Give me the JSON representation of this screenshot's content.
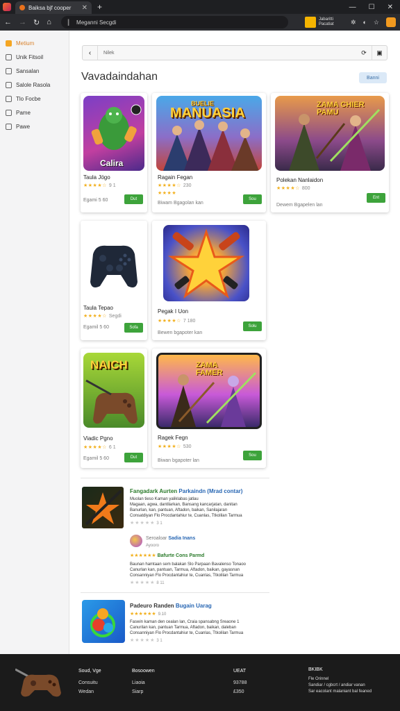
{
  "browser": {
    "tab_title": "Baiksa bjf cooper",
    "address": "Meganni Secgdi",
    "profile_name": "Jabaritti Pacatiat"
  },
  "sidebar": {
    "items": [
      {
        "label": "Metium",
        "icon": "home-icon",
        "active": true
      },
      {
        "label": "Unik Fitsoil",
        "icon": "list-icon"
      },
      {
        "label": "Sansalan",
        "icon": "bookmark-icon"
      },
      {
        "label": "Salole Rasola",
        "icon": "document-icon"
      },
      {
        "label": "Tlo Focbe",
        "icon": "circle-icon"
      },
      {
        "label": "Pame",
        "icon": "square-icon"
      },
      {
        "label": "Pawe",
        "icon": "square-icon"
      }
    ]
  },
  "toolbar": {
    "search_text": "Nilek"
  },
  "page": {
    "title": "Vavadaindahan",
    "top_button": "Banni"
  },
  "cards": [
    {
      "name": "Taula Jögo",
      "rating_count": "9 1",
      "sub": "Egami 5 60",
      "button": "Dut",
      "art_text": "Calira"
    },
    {
      "name": "Ragain Fegan",
      "rating_count": "230",
      "sub": "Biwam Bgagolan kan",
      "button": "Sou",
      "art_text": "MANUASIA",
      "art_top": "BUELIE"
    },
    {
      "name": "Polekan Nanlaidon",
      "rating_count": "800",
      "sub": "Dewem Bgapelen lan",
      "button": "Ent",
      "art_text": "ZAMA CHIER PAMU"
    },
    {
      "name": "Taula Tepao",
      "rating_count": "Segdi",
      "sub": "Egamil 5 60",
      "button": "Sofa",
      "art_text": ""
    },
    {
      "name": "Pegak I Uon",
      "rating_count": "7 180",
      "sub": "Bewen bgapoter kan",
      "button": "Solu",
      "art_text": ""
    },
    {
      "name": "Viadic Pgno",
      "rating_count": "6 1",
      "sub": "Egamil 5 60",
      "button": "Dut",
      "art_text": "NAICH"
    },
    {
      "name": "Ragek Fegn",
      "rating_count": "530",
      "sub": "Biwan bgapoter lan",
      "button": "Sou",
      "art_text": "ZAMA FAMER"
    }
  ],
  "reviews": [
    {
      "title": "Fangadark Aurten",
      "title2": "Parkaindn (Mrad contar)",
      "lines": [
        "Muolan tieso Kaman yaliklabas jatlau",
        "Magaan, agwa, dantilarkan, Bansang kancarjatan, danitan",
        "Banurlan, kan, pantuan, Aftadon, baikan, Sanilajaran",
        "Consatdiyan Flo Procdantahiur te, Cuanlas, Ttkolilan Tarmua"
      ],
      "rating_count": "3 1"
    },
    {
      "reviewer_prefix": "Seroaloar",
      "reviewer": "Sadia Inans",
      "reviewer_sub": "Ayooro",
      "title": "Bafurte Cons Parmd",
      "lines": [
        "Baunan hamtaan sem balakan Slo Parpaan Bavalenso Tonaoo",
        "Canurlan kan, pantuan, Tarmua, Aftadon, baikan, gayasnan",
        "Consanniyan Flo Procdantahiur te, Cuanlas, Ttkolilan Tarmua"
      ],
      "rating_count": "8 11"
    },
    {
      "title": "Padeuro Randen",
      "title2": "Bugain Uarag",
      "rating_count": "9.10",
      "lines": [
        "Faswin kaman den cealan lan, Craia spansabng Sreaone 1",
        "Canurilan kan, pantuan Tarmua, Aftadon, baikan, daleban",
        "Consanniyan Flo Procdantahiur te, Cuanlas, Ttkolilan Tarmua"
      ],
      "dots_count": "3 1"
    }
  ],
  "footer": {
    "col1": [
      "Soud, Vge",
      "Consuitu",
      "Wedan"
    ],
    "col2": [
      "Bosoowen",
      "Liaoia",
      "Siarp"
    ],
    "col3": [
      "UEAT",
      "93788",
      "£350"
    ],
    "col4": [
      "BKIBK",
      "Fle Orinnel",
      "Sandiar / cgbcrt / andiar vanan",
      "Sar eacolant malaniant bal feaned"
    ]
  },
  "colors": {
    "accent": "#f5a623",
    "green": "#3da33b",
    "blue": "#2766b3",
    "star": "#f2b01e"
  }
}
